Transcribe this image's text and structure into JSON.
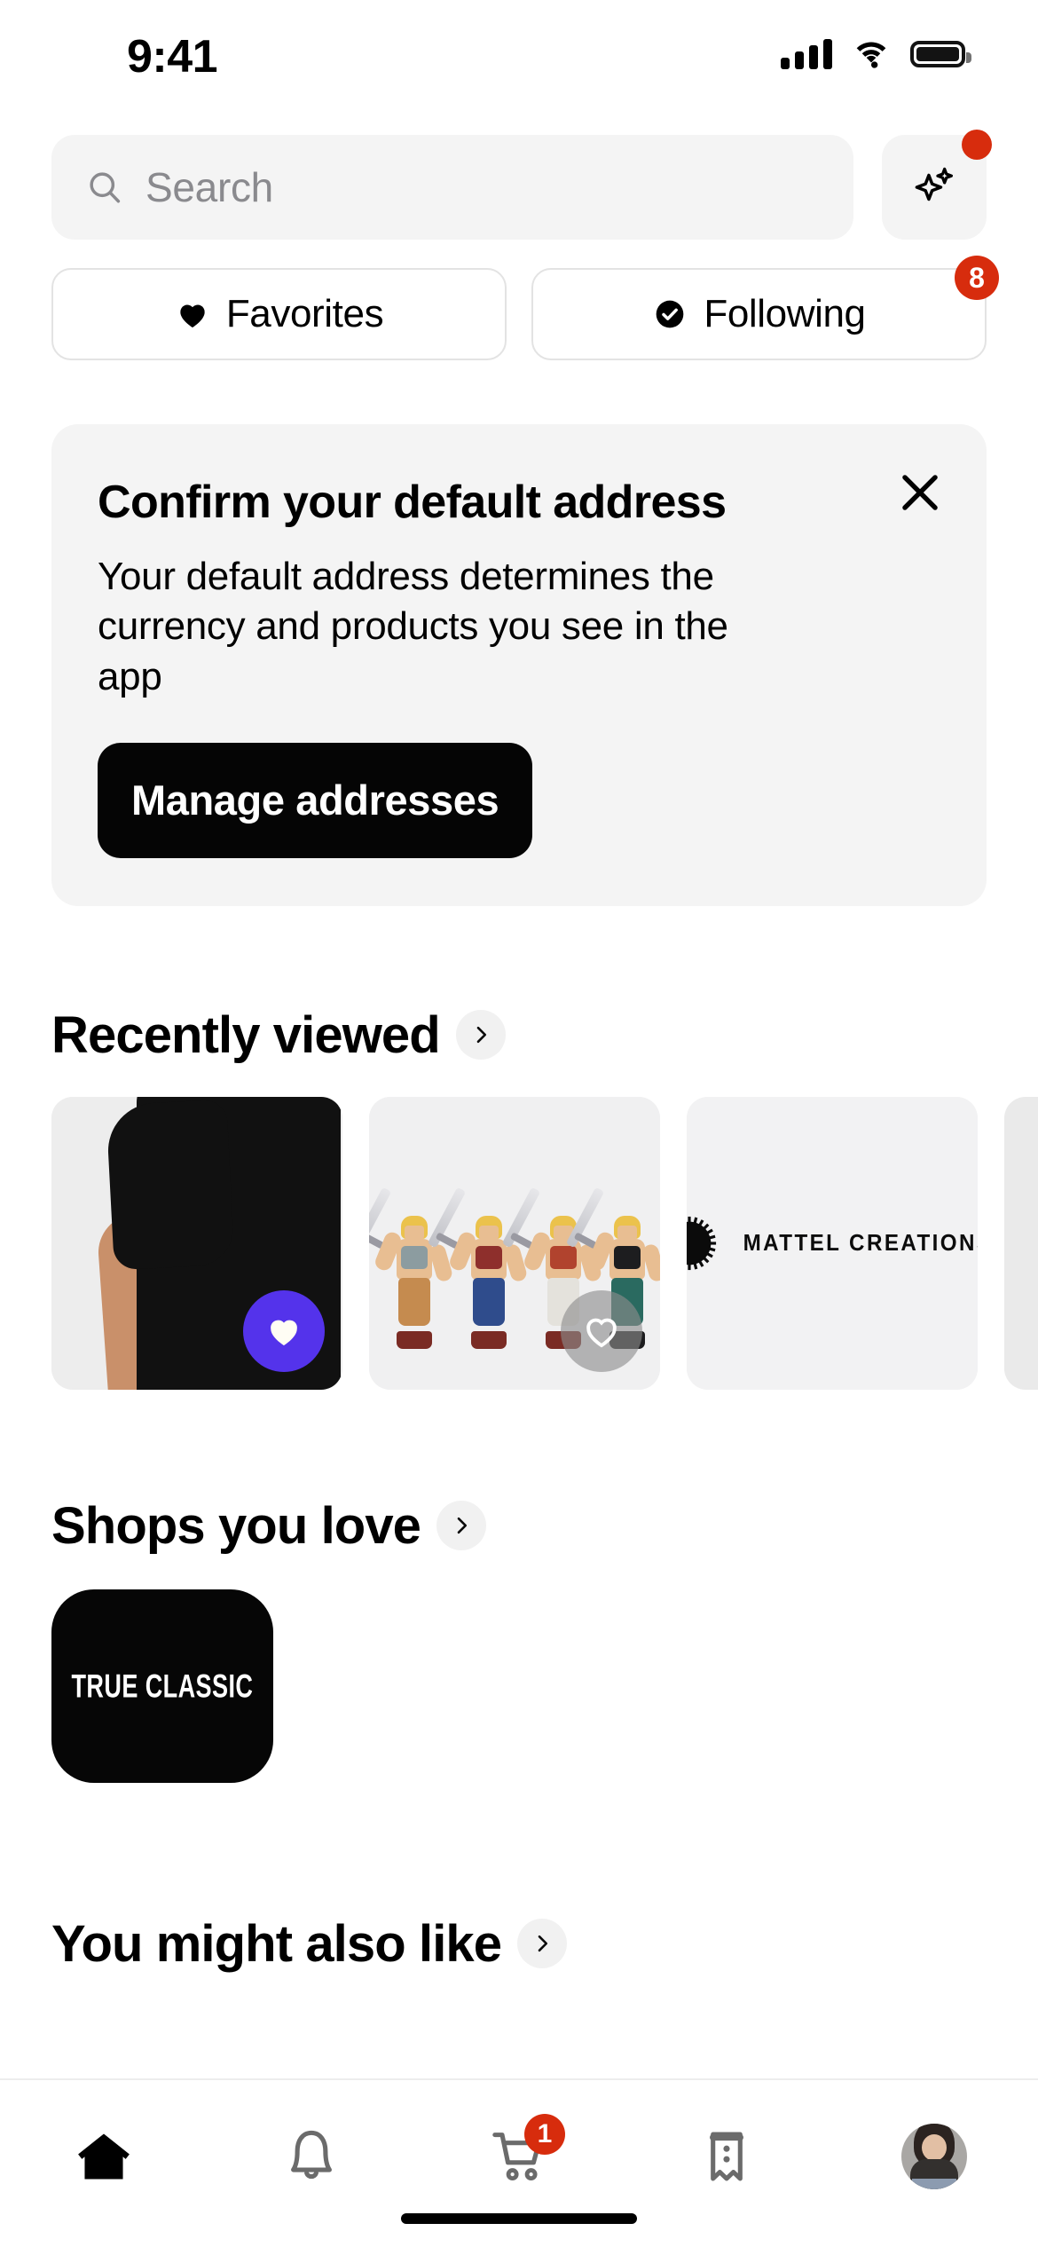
{
  "status_bar": {
    "time": "9:41",
    "cellular_icon": "cellular-signal-icon",
    "wifi_icon": "wifi-icon",
    "battery_icon": "battery-full-icon"
  },
  "search": {
    "placeholder": "Search",
    "icon": "search-icon",
    "ai_button": {
      "icon": "sparkle-ai-icon",
      "badge": ""
    }
  },
  "filters": [
    {
      "label": "Favorites",
      "icon": "heart-filled-icon",
      "badge": ""
    },
    {
      "label": "Following",
      "icon": "check-circle-icon",
      "badge": "8"
    }
  ],
  "address_card": {
    "title": "Confirm your default address",
    "body": "Your default address determines the currency and products you see in the app",
    "button_label": "Manage addresses",
    "close_icon": "close-icon"
  },
  "sections": {
    "recently_viewed": {
      "title": "Recently viewed",
      "chevron_icon": "chevron-right-icon",
      "items": [
        {
          "name": "black-tshirt-product",
          "favorited": true,
          "heart_icon": "heart-filled-icon"
        },
        {
          "name": "he-man-action-figures-product",
          "favorited": false,
          "heart_icon": "heart-outline-icon"
        },
        {
          "name": "mattel-creations-shop",
          "logo_text": "MATTEL CREATIONS"
        },
        {
          "name": "black-cap-product"
        }
      ]
    },
    "shops_you_love": {
      "title": "Shops you love",
      "chevron_icon": "chevron-right-icon",
      "shops": [
        {
          "name": "true-classic",
          "label": "TRUE CLASSIC"
        }
      ]
    },
    "you_might_also_like": {
      "title": "You might also like",
      "chevron_icon": "chevron-right-icon"
    }
  },
  "tabbar": {
    "tabs": [
      {
        "name": "home",
        "icon": "home-icon",
        "active": true,
        "badge": ""
      },
      {
        "name": "notifications",
        "icon": "bell-icon",
        "active": false,
        "badge": ""
      },
      {
        "name": "cart",
        "icon": "shopping-cart-icon",
        "active": false,
        "badge": "1"
      },
      {
        "name": "orders",
        "icon": "receipt-icon",
        "active": false,
        "badge": ""
      },
      {
        "name": "profile",
        "icon": "avatar-icon",
        "active": false,
        "badge": ""
      }
    ]
  },
  "colors": {
    "accent_purple": "#5433EB",
    "badge_red": "#D72C0D",
    "surface_gray": "#F4F4F4",
    "ink": "#000000"
  }
}
